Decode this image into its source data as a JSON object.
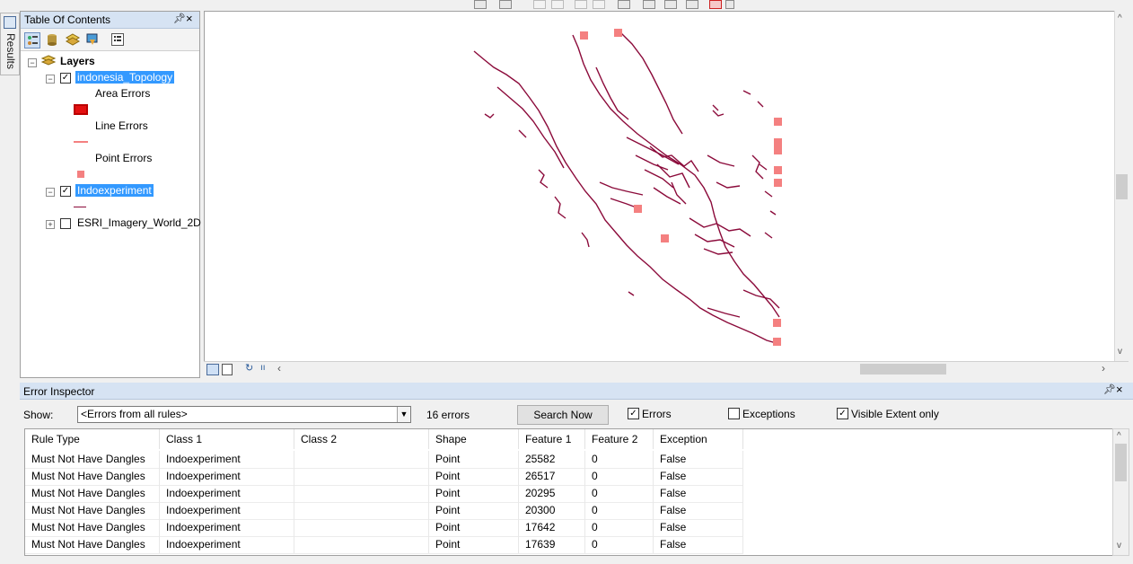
{
  "side_tab": {
    "label": "Results",
    "icon": "results-window-icon"
  },
  "toc": {
    "title": "Table Of Contents",
    "pin_glyph": "ᵖ",
    "close_glyph": "×",
    "toolbar_icons": [
      "list-by-drawing-order-icon",
      "list-by-source-icon",
      "list-by-visibility-icon",
      "list-by-selection-icon",
      "options-icon"
    ],
    "root": {
      "label": "Layers",
      "icon": "layers-icon"
    },
    "layers": [
      {
        "name": "indonesia_Topology",
        "checked": true,
        "selected": true,
        "legend": [
          {
            "label": "Area Errors",
            "symbol": "area"
          },
          {
            "label": "Line Errors",
            "symbol": "line"
          },
          {
            "label": "Point Errors",
            "symbol": "point"
          }
        ]
      },
      {
        "name": "Indoexperiment",
        "checked": true,
        "selected": true,
        "legend": [
          {
            "label": "",
            "symbol": "line-dark"
          }
        ]
      },
      {
        "name": "ESRI_Imagery_World_2D",
        "checked": false,
        "selected": false,
        "legend": []
      }
    ]
  },
  "map": {
    "feature_color": "#8b0a3a",
    "error_marker_color": "#f48080",
    "area_error_color": "#e31010"
  },
  "error_inspector": {
    "title": "Error Inspector",
    "show_label": "Show:",
    "show_value": "<Errors from all rules>",
    "error_count": "16 errors",
    "search_button": "Search Now",
    "errors_checkbox": {
      "label": "Errors",
      "checked": true
    },
    "exceptions_checkbox": {
      "label": "Exceptions",
      "checked": false
    },
    "visible_extent_checkbox": {
      "label": "Visible Extent only",
      "checked": true
    },
    "columns": [
      "Rule Type",
      "Class 1",
      "Class 2",
      "Shape",
      "Feature 1",
      "Feature 2",
      "Exception"
    ],
    "rows": [
      [
        "Must Not Have Dangles",
        "Indoexperiment",
        "",
        "Point",
        "25582",
        "0",
        "False"
      ],
      [
        "Must Not Have Dangles",
        "Indoexperiment",
        "",
        "Point",
        "26517",
        "0",
        "False"
      ],
      [
        "Must Not Have Dangles",
        "Indoexperiment",
        "",
        "Point",
        "20295",
        "0",
        "False"
      ],
      [
        "Must Not Have Dangles",
        "Indoexperiment",
        "",
        "Point",
        "20300",
        "0",
        "False"
      ],
      [
        "Must Not Have Dangles",
        "Indoexperiment",
        "",
        "Point",
        "17642",
        "0",
        "False"
      ],
      [
        "Must Not Have Dangles",
        "Indoexperiment",
        "",
        "Point",
        "17639",
        "0",
        "False"
      ]
    ]
  }
}
